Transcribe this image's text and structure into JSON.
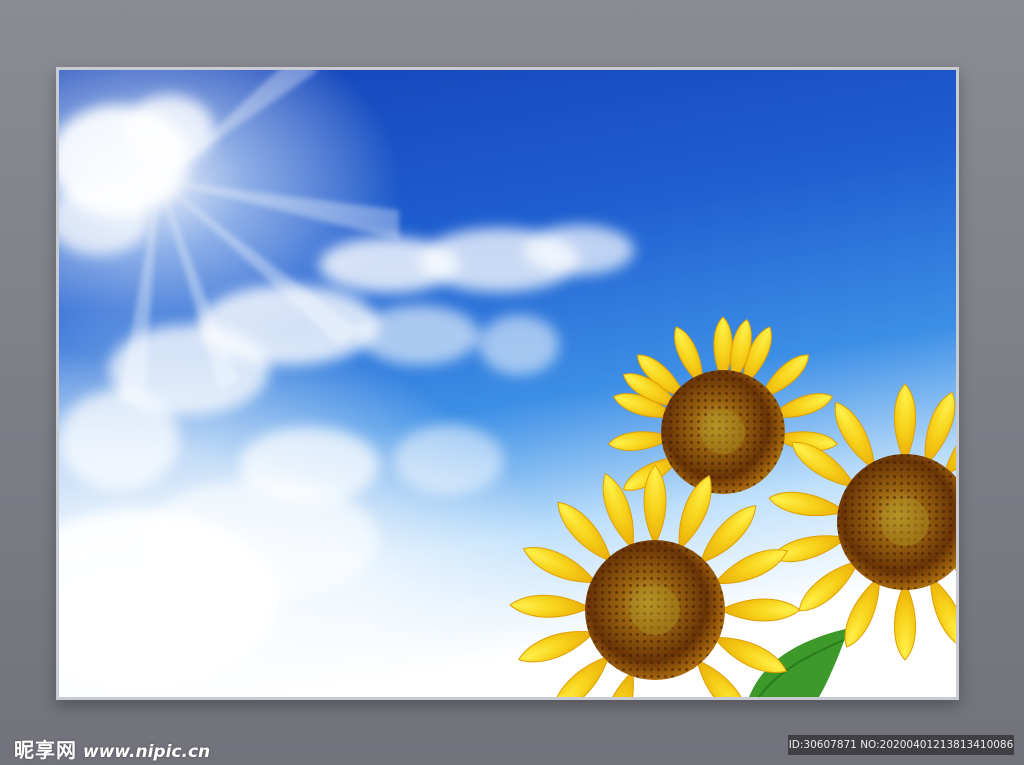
{
  "watermark": {
    "logo_text": "昵享网",
    "site_url": "www.nipic.cn",
    "id_text": "ID:30607871 NO:20200401213813410086"
  },
  "scene": {
    "subject": "sunflowers",
    "flower_count": 3,
    "colors": {
      "sky_top": "#0f3db5",
      "sky_mid": "#2f7de0",
      "sky_horizon": "#ffffff",
      "petal": "#f7d21a",
      "petal_shadow": "#e9a806",
      "center": "#7a4208",
      "leaf": "#3d9a2a",
      "frame_border": "#c9cbd2",
      "wall": "#808088"
    }
  }
}
